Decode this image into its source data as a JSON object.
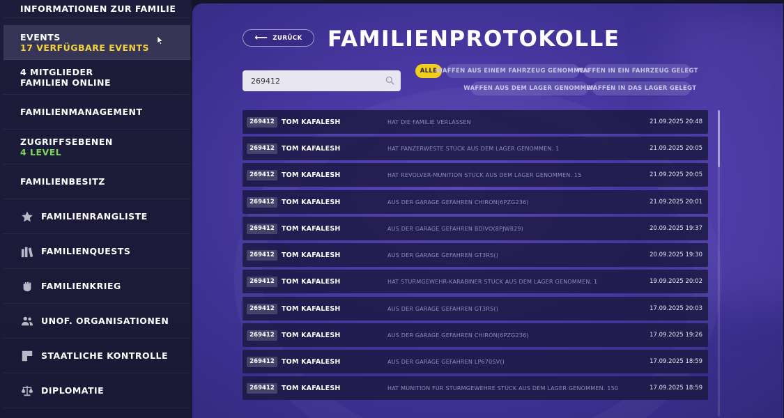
{
  "sidebar": {
    "items": [
      {
        "label": "INFORMATIONEN ZUR FAMILIE"
      },
      {
        "label": "EVENTS",
        "sub": "17 VERFÜGBARE EVENTS",
        "sub_color": "#f2d33b"
      },
      {
        "label": "4 MITGLIEDER",
        "sub": "FAMILIEN ONLINE",
        "sub_color": "#ffffff"
      },
      {
        "label": "FAMILIENMANAGEMENT"
      },
      {
        "label": "ZUGRIFFSEBENEN",
        "sub": "4 LEVEL",
        "sub_color": "#7fd75a"
      },
      {
        "label": "FAMILIENBESITZ"
      },
      {
        "label": "FAMILIENRANGLISTE",
        "icon": "star-icon"
      },
      {
        "label": "FAMILIENQUESTS",
        "icon": "books-icon"
      },
      {
        "label": "FAMILIENKRIEG",
        "icon": "fist-icon"
      },
      {
        "label": "UNOF. ORGANISATIONEN",
        "icon": "people-icon"
      },
      {
        "label": "STAATLICHE KONTROLLE",
        "icon": "flag-icon"
      },
      {
        "label": "DIPLOMATIE",
        "icon": "scales-icon"
      }
    ]
  },
  "header": {
    "back_label": "ZURÜCK",
    "title": "FAMILIENPROTOKOLLE"
  },
  "search": {
    "value": "269412"
  },
  "filters": [
    {
      "label": "ALLE",
      "active": true
    },
    {
      "label": "WAFFEN AUS EINEM FAHRZEUG GENOMMEN"
    },
    {
      "label": "WAFFEN IN EIN FAHRZEUG GELEGT"
    },
    {
      "label": "WAFFEN AUS DEM LAGER GENOMMEN"
    },
    {
      "label": "WAFFEN IN DAS LAGER GELEGT"
    }
  ],
  "log": [
    {
      "id": "269412",
      "name": "TOM KAFALESH",
      "action": "HAT DIE FAMILIE VERLASSEN",
      "time": "21.09.2025 20:48"
    },
    {
      "id": "269412",
      "name": "TOM KAFALESH",
      "action": "HAT PANZERWESTE STÜCK AUS DEM LAGER GENOMMEN. 1",
      "time": "21.09.2025 20:05"
    },
    {
      "id": "269412",
      "name": "TOM KAFALESH",
      "action": "HAT REVOLVER-MUNITION STÜCK AUS DEM LAGER GENOMMEN. 15",
      "time": "21.09.2025 20:05"
    },
    {
      "id": "269412",
      "name": "TOM KAFALESH",
      "action": "AUS DER GARAGE GEFAHREN CHIRON(6PZG236)",
      "time": "21.09.2025 20:01"
    },
    {
      "id": "269412",
      "name": "TOM KAFALESH",
      "action": "AUS DER GARAGE GEFAHREN BDIVO(8PJW829)",
      "time": "20.09.2025 19:37"
    },
    {
      "id": "269412",
      "name": "TOM KAFALESH",
      "action": "AUS DER GARAGE GEFAHREN GT3RS()",
      "time": "20.09.2025 19:30"
    },
    {
      "id": "269412",
      "name": "TOM KAFALESH",
      "action": "HAT STURMGEWEHR-KARABINER STÜCK AUS DEM LAGER GENOMMEN. 1",
      "time": "19.09.2025 20:02"
    },
    {
      "id": "269412",
      "name": "TOM KAFALESH",
      "action": "AUS DER GARAGE GEFAHREN GT3RS()",
      "time": "17.09.2025 20:03"
    },
    {
      "id": "269412",
      "name": "TOM KAFALESH",
      "action": "AUS DER GARAGE GEFAHREN CHIRON(6PZG236)",
      "time": "17.09.2025 19:26"
    },
    {
      "id": "269412",
      "name": "TOM KAFALESH",
      "action": "AUS DER GARAGE GEFAHREN LP670SV()",
      "time": "17.09.2025 18:59"
    },
    {
      "id": "269412",
      "name": "TOM KAFALESH",
      "action": "HAT MUNITION FÜR STURMGEWEHRE STÜCK AUS DEM LAGER GENOMMEN. 150",
      "time": "17.09.2025 18:59"
    }
  ],
  "colors": {
    "accent_yellow": "#f0cf1d",
    "sidebar_bg": "#1d1c3a",
    "panel_bg": "#4a39a4"
  }
}
